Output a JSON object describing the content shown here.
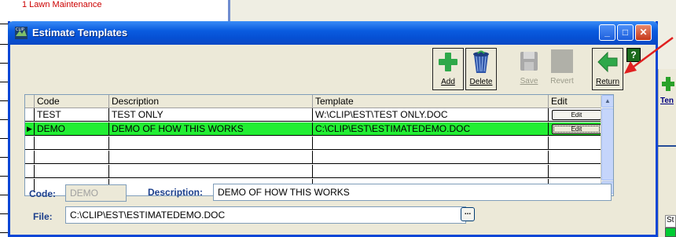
{
  "background": {
    "top_item": "1 Lawn Maintenance",
    "right_tool_label": "Ten",
    "status_label": "St"
  },
  "window": {
    "title": "Estimate Templates",
    "title_icon": "app-logo-icon",
    "minimize": "_",
    "maximize": "□",
    "close": "✕"
  },
  "toolbar": {
    "add": "Add",
    "delete": "Delete",
    "save": "Save",
    "revert": "Revert",
    "return": "Return",
    "help": "?"
  },
  "grid": {
    "columns": [
      "Code",
      "Description",
      "Template",
      "Edit"
    ],
    "rows": [
      {
        "code": "TEST",
        "description": "TEST ONLY",
        "template": "W:\\CLIP\\EST\\TEST ONLY.DOC",
        "edit": "Edit"
      },
      {
        "code": "DEMO",
        "description": "DEMO OF HOW THIS WORKS",
        "template": "C:\\CLIP\\EST\\ESTIMATEDEMO.DOC",
        "edit": "Edit"
      }
    ],
    "selected_row": 1,
    "row_indicator": "▶",
    "scroll_up": "▲",
    "scroll_down": "▼"
  },
  "form": {
    "code_label": "Code:",
    "code_value": "DEMO",
    "description_label": "Description:",
    "description_value": "DEMO OF HOW THIS WORKS",
    "file_label": "File:",
    "file_value": "C:\\CLIP\\EST\\ESTIMATEDEMO.DOC",
    "browse_label": "..."
  },
  "colors": {
    "titlebar": "#0a5ce0",
    "selected_row": "#22ee33",
    "label_text": "#1c3f8c",
    "annotation_arrow": "#e02020"
  }
}
